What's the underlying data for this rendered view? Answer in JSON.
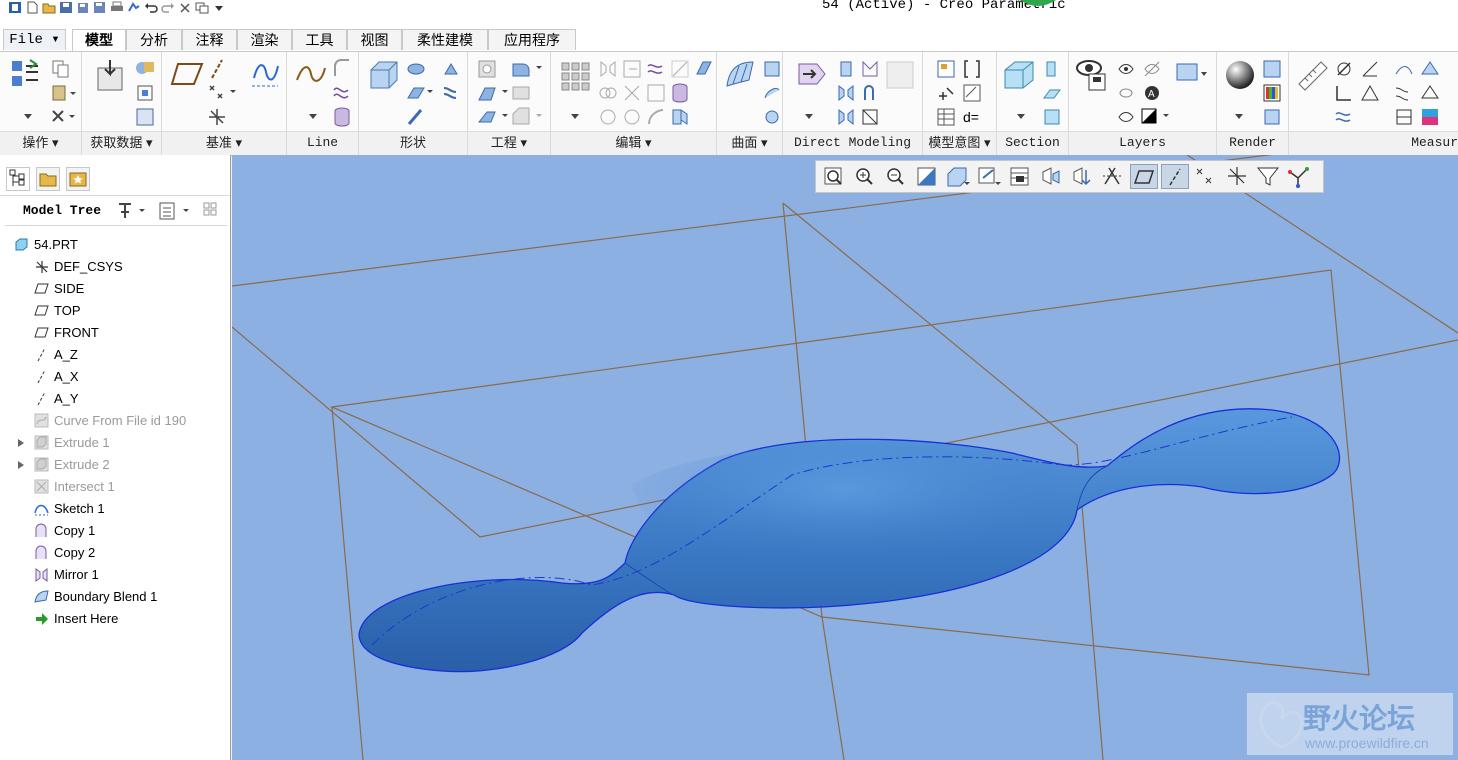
{
  "window": {
    "title": "54 (Active) - Creo Parametric"
  },
  "quick_access_icons": [
    "app-icon",
    "new-icon",
    "open-icon",
    "save-icon",
    "save-copy-icon",
    "save-backup-icon",
    "print-icon",
    "regenerate-icon",
    "undo-icon",
    "redo-icon",
    "close-window-icon",
    "windows-icon",
    "customize-icon"
  ],
  "tabs": [
    {
      "label": "File"
    },
    {
      "label": "模型",
      "active": true
    },
    {
      "label": "分析"
    },
    {
      "label": "注释"
    },
    {
      "label": "渲染"
    },
    {
      "label": "工具"
    },
    {
      "label": "视图"
    },
    {
      "label": "柔性建模"
    },
    {
      "label": "应用程序"
    }
  ],
  "ribbon": {
    "groups": [
      {
        "label": "操作"
      },
      {
        "label": "获取数据"
      },
      {
        "label": "基准"
      },
      {
        "label": "Line"
      },
      {
        "label": "形状"
      },
      {
        "label": "工程"
      },
      {
        "label": "编辑"
      },
      {
        "label": "曲面"
      },
      {
        "label": "Direct Modeling"
      },
      {
        "label": "模型意图"
      },
      {
        "label": "Section"
      },
      {
        "label": "Layers"
      },
      {
        "label": "Render"
      },
      {
        "label": "Measur"
      }
    ]
  },
  "model_tree": {
    "header": "Model Tree",
    "nodes": [
      {
        "label": "54.PRT",
        "icon": "part-icon"
      },
      {
        "label": "DEF_CSYS",
        "icon": "csys-icon"
      },
      {
        "label": "SIDE",
        "icon": "datum-plane-icon"
      },
      {
        "label": "TOP",
        "icon": "datum-plane-icon"
      },
      {
        "label": "FRONT",
        "icon": "datum-plane-icon"
      },
      {
        "label": "A_Z",
        "icon": "axis-icon"
      },
      {
        "label": "A_X",
        "icon": "axis-icon"
      },
      {
        "label": "A_Y",
        "icon": "axis-icon"
      },
      {
        "label": "Curve From File id 190",
        "icon": "curve-icon",
        "suppressed": true
      },
      {
        "label": "Extrude 1",
        "icon": "extrude-icon",
        "suppressed": true,
        "expandable": true
      },
      {
        "label": "Extrude 2",
        "icon": "extrude-icon",
        "suppressed": true,
        "expandable": true
      },
      {
        "label": "Intersect 1",
        "icon": "intersect-icon",
        "suppressed": true
      },
      {
        "label": "Sketch 1",
        "icon": "sketch-icon"
      },
      {
        "label": "Copy 1",
        "icon": "copy-icon"
      },
      {
        "label": "Copy 2",
        "icon": "copy-icon"
      },
      {
        "label": "Mirror 1",
        "icon": "mirror-icon"
      },
      {
        "label": "Boundary Blend 1",
        "icon": "boundary-blend-icon"
      },
      {
        "label": "Insert Here",
        "icon": "insert-arrow-icon"
      }
    ]
  },
  "graphics_toolbar": {
    "buttons": [
      "refit-icon",
      "zoom-in-icon",
      "zoom-out-icon",
      "repaint-icon",
      "display-style-icon",
      "saved-orientations-icon",
      "view-manager-icon",
      "perspective-icon",
      "spin-center-icon",
      "annotation-display-icon",
      "plane-display-icon",
      "axis-display-icon",
      "point-display-icon",
      "csys-display-icon",
      "appearance-icon",
      "simulation-icon"
    ]
  },
  "watermark": {
    "title": "野火论坛",
    "url": "www.proewildfire.cn"
  },
  "colors": {
    "viewport_bg": "#8db0e3",
    "surface": "#3a78c4",
    "edge": "#1530d8",
    "datum_plane": "#8b6a4a"
  }
}
